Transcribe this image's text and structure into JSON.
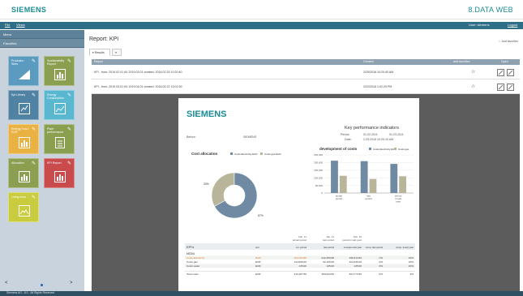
{
  "brand": {
    "logo": "SIEMENS",
    "app_name": "8.DATA WEB"
  },
  "menubar": {
    "left": [
      "File",
      "Views"
    ],
    "user": "User: siemens",
    "logout": "Logout"
  },
  "sidebar": {
    "header": "Menu",
    "subheader": "Favorites",
    "tiles": [
      {
        "label": "Products / Sites",
        "color": "#5a9bbf",
        "icon": "triangle-chart-icon"
      },
      {
        "label": "Sustainability Report",
        "color": "#8a9f4f",
        "icon": "bar-report-icon"
      },
      {
        "label": "Kpi Library",
        "color": "#4f82a3",
        "icon": "gauge-icon"
      },
      {
        "label": "Energy Consumption",
        "color": "#5ab7d0",
        "icon": "trend-icon"
      },
      {
        "label": "Energy Cost / EUR",
        "color": "#e9b243",
        "icon": "bar-report-icon"
      },
      {
        "label": "Plant performance",
        "color": "#8a9f4f",
        "icon": "document-icon"
      },
      {
        "label": "Allocation",
        "color": "#8a9f4f",
        "icon": "bar-report-icon"
      },
      {
        "label": "KPI Report",
        "color": "#c94b4b",
        "icon": "bar-report-icon"
      },
      {
        "label": "Living Area",
        "color": "#c9cc3f",
        "icon": "image-icon"
      }
    ],
    "pager": {
      "prev": "<",
      "next": ">"
    }
  },
  "main": {
    "title": "Report: KPI",
    "add_favorite": "Add favorites",
    "tabs": [
      {
        "label": "Results"
      },
      {
        "label": "≡"
      }
    ],
    "columns": [
      "Report",
      "Created",
      "add favorites",
      "Open"
    ],
    "rows": [
      {
        "report": "KPI - from: 2019.02.01 till: 2019.03.01 created: 2016.02.25 10:20:40",
        "created": "2/25/2016 10:20:40 AM",
        "fav": "☆"
      },
      {
        "report": "KPI - from: 2019.03.01 till: 2019.04.01 created: 2016.02.22 13:01:59",
        "created": "2/22/2016 1:02:29 PM",
        "fav": "☆"
      }
    ]
  },
  "pdf": {
    "logo": "SIEMENS",
    "heading": "Key performance indicators",
    "before_label": "Before:",
    "before_value": "SIEMENS",
    "period_label": "Period:",
    "period_from": "01.02.2011",
    "period_to": "01.03.2011",
    "date_label": "Date:",
    "date_value": "2.25.2016 10:20:10 AM",
    "pie": {
      "title": "Cost allocation",
      "legend": [
        "Costs Electricity EUR",
        "Costs gas EUR"
      ],
      "labels": [
        "33%",
        "67%"
      ]
    },
    "bars": {
      "title": "development of costs",
      "legend": [
        "Costs Electricity EUR",
        "Costs gas"
      ],
      "yticks": [
        "250,000",
        "200,000",
        "150,000",
        "100,000",
        "50,000",
        "0"
      ],
      "categories": [
        "actual period",
        "last period",
        "period in last year"
      ],
      "elec": [
        212000,
        209000,
        191000
      ],
      "gas": [
        113000,
        92000,
        110000
      ]
    },
    "kpi_table": {
      "period_headers": [
        [
          "Feb. 11",
          "actual period"
        ],
        [
          "Jan. 11",
          "last period"
        ],
        [
          "Feb. 10",
          "period in last year"
        ]
      ],
      "sub_header": [
        "KPI's",
        "unit",
        "cur. period",
        "last period",
        "compare last year",
        "comp. last period",
        "comp. (Last) year"
      ],
      "groups": "MEDIA",
      "rows": [
        {
          "name": "Costs Electricity",
          "unit": "EUR",
          "cur": "194,364.88",
          "last": "212,359.98",
          "ly": "196,314.52",
          "c1": "-7%",
          "c2": "10%",
          "highlight": true
        },
        {
          "name": "Costs gas",
          "unit": "EUR",
          "cur": "114,000.00",
          "last": "92,100.00",
          "ly": "104,330.00",
          "c1": "-1%",
          "c2": "10%"
        },
        {
          "name": "Costs water",
          "unit": "EUR",
          "cur": "135.00",
          "last": "135.00",
          "ly": "135.00",
          "c1": "0%",
          "c2": "10%"
        }
      ],
      "total": {
        "name": "Total costs",
        "unit": "EUR",
        "cur": "312,467.50",
        "last": "309,643.60",
        "ly": "304,773.50",
        "c1": "2%",
        "c2": "3%"
      }
    }
  },
  "status": "Siemens AG - 8.0 - All Rights Reserved"
}
